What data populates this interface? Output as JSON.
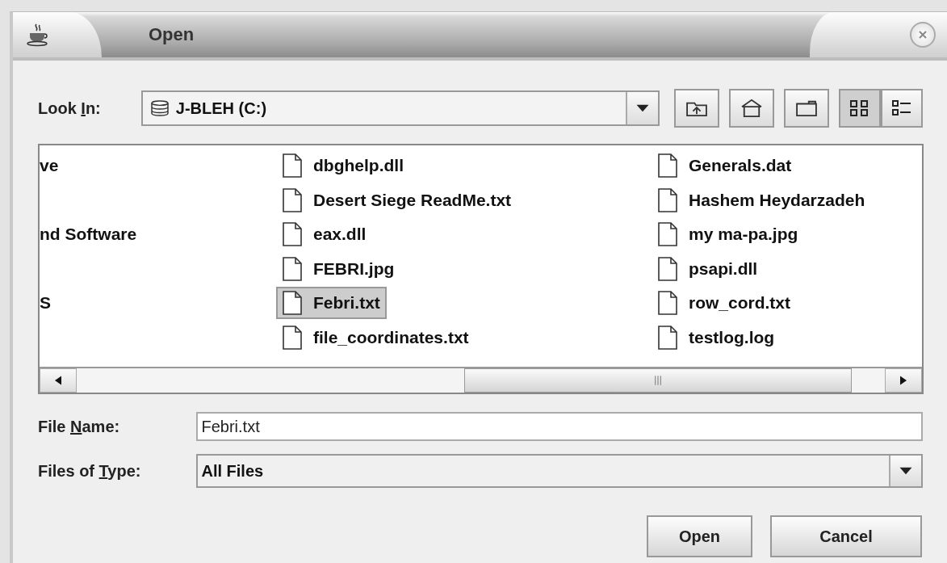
{
  "window": {
    "title": "Open"
  },
  "look_in": {
    "label_parts": [
      "Look ",
      "I",
      "n:"
    ],
    "value": "J-BLEH (C:)"
  },
  "toolbar": [
    {
      "kind": "up"
    },
    {
      "kind": "home"
    },
    {
      "kind": "new-folder"
    },
    {
      "kind": "list",
      "selected": true
    },
    {
      "kind": "details",
      "selected": false
    }
  ],
  "file_list": {
    "columns": [
      [
        {
          "kind": "clipped",
          "name": "ve"
        },
        {
          "kind": "blank"
        },
        {
          "kind": "clipped",
          "name": "nd Software"
        },
        {
          "kind": "blank"
        },
        {
          "kind": "clipped",
          "name": "S"
        },
        {
          "kind": "blank"
        }
      ],
      [
        {
          "kind": "file",
          "name": "dbghelp.dll",
          "selected": false
        },
        {
          "kind": "file",
          "name": "Desert Siege ReadMe.txt",
          "selected": false
        },
        {
          "kind": "file",
          "name": "eax.dll",
          "selected": false
        },
        {
          "kind": "file",
          "name": "FEBRI.jpg",
          "selected": false
        },
        {
          "kind": "file",
          "name": "Febri.txt",
          "selected": true
        },
        {
          "kind": "file",
          "name": "file_coordinates.txt",
          "selected": false
        }
      ],
      [
        {
          "kind": "file",
          "name": "Generals.dat",
          "selected": false
        },
        {
          "kind": "file",
          "name": "Hashem Heydarzadeh",
          "selected": false
        },
        {
          "kind": "file",
          "name": "my ma-pa.jpg",
          "selected": false
        },
        {
          "kind": "file",
          "name": "psapi.dll",
          "selected": false
        },
        {
          "kind": "file",
          "name": "row_cord.txt",
          "selected": false
        },
        {
          "kind": "file",
          "name": "testlog.log",
          "selected": false
        }
      ]
    ]
  },
  "file_name": {
    "label_parts": [
      "File ",
      "N",
      "ame:"
    ],
    "value": "Febri.txt"
  },
  "file_type": {
    "label_parts": [
      "Files of ",
      "T",
      "ype:"
    ],
    "value": "All Files"
  },
  "buttons": [
    "Open",
    "Cancel"
  ]
}
